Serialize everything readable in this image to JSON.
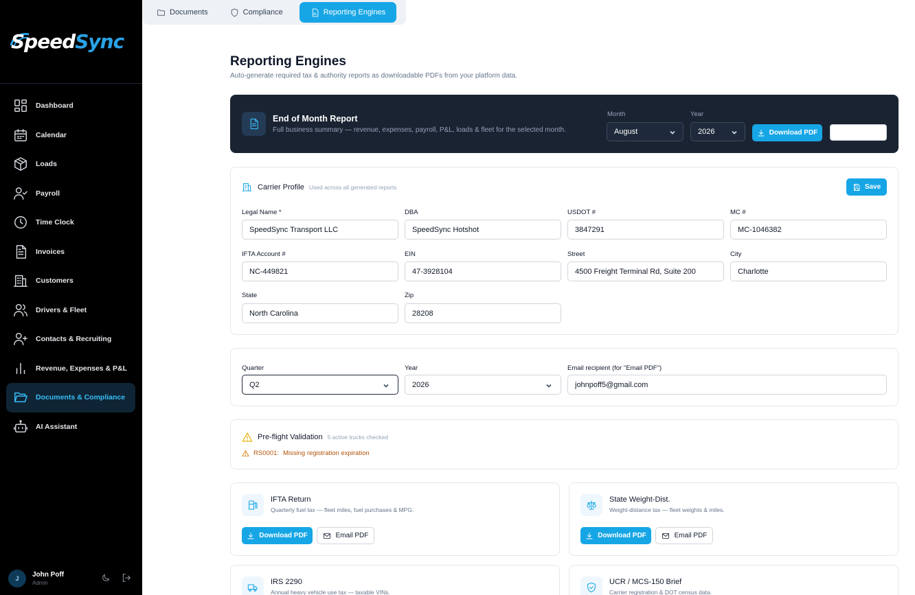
{
  "brand": {
    "name_part1": "Speed",
    "name_part2": "Sync",
    "accent": "#16a6e6"
  },
  "tabs": [
    {
      "label": "Documents",
      "icon": "folder-icon"
    },
    {
      "label": "Compliance",
      "icon": "shield-icon"
    },
    {
      "label": "Reporting Engines",
      "icon": "report-icon",
      "active": true
    }
  ],
  "sidebar": {
    "items": [
      {
        "label": "Dashboard",
        "icon": "dashboard-icon"
      },
      {
        "label": "Calendar",
        "icon": "calendar-icon"
      },
      {
        "label": "Loads",
        "icon": "box-icon"
      },
      {
        "label": "Payroll",
        "icon": "user-check-icon"
      },
      {
        "label": "Time Clock",
        "icon": "clock-icon"
      },
      {
        "label": "Invoices",
        "icon": "invoice-icon"
      },
      {
        "label": "Customers",
        "icon": "building-icon"
      },
      {
        "label": "Drivers & Fleet",
        "icon": "users-icon"
      },
      {
        "label": "Contacts & Recruiting",
        "icon": "user-plus-icon"
      },
      {
        "label": "Revenue, Expenses & P&L",
        "icon": "bar-chart-icon"
      },
      {
        "label": "Documents & Compliance",
        "icon": "folder-open-icon",
        "active": true
      },
      {
        "label": "AI Assistant",
        "icon": "bot-icon"
      }
    ]
  },
  "user": {
    "initial": "J",
    "name": "John Poff",
    "role": "Admin"
  },
  "page": {
    "title": "Reporting Engines",
    "subtitle": "Auto-generate required tax & authority reports as downloadable PDFs from your platform data."
  },
  "eom": {
    "title": "End of Month Report",
    "description": "Full business summary — revenue, expenses, payroll, P&L, loads & fleet for the selected month.",
    "month_label": "Month",
    "month_value": "August",
    "year_label": "Year",
    "year_value": "2026",
    "download_label": "Download PDF"
  },
  "carrier": {
    "title": "Carrier Profile",
    "note": "Used across all generated reports",
    "save_label": "Save",
    "fields": {
      "legal_name": {
        "label": "Legal Name *",
        "value": "SpeedSync Transport LLC"
      },
      "dba": {
        "label": "DBA",
        "value": "SpeedSync Hotshot"
      },
      "usdot": {
        "label": "USDOT #",
        "value": "3847291"
      },
      "mc": {
        "label": "MC #",
        "value": "MC-1046382"
      },
      "ifta": {
        "label": "IFTA Account #",
        "value": "NC-449821"
      },
      "ein": {
        "label": "EIN",
        "value": "47-3928104"
      },
      "street": {
        "label": "Street",
        "value": "4500 Freight Terminal Rd, Suite 200"
      },
      "city": {
        "label": "City",
        "value": "Charlotte"
      },
      "state": {
        "label": "State",
        "value": "North Carolina"
      },
      "zip": {
        "label": "Zip",
        "value": "28208"
      }
    }
  },
  "period": {
    "quarter_label": "Quarter",
    "quarter_value": "Q2",
    "year_label": "Year",
    "year_value": "2026",
    "email_label": "Email recipient (for \"Email PDF\")",
    "email_value": "johnpoff5@gmail.com"
  },
  "preflight": {
    "title": "Pre-flight Validation",
    "note": "5 active trucks checked",
    "warning_code": "RS0001:",
    "warning_text": "Missing registration expiration"
  },
  "reports": [
    {
      "title": "IFTA Return",
      "description": "Quarterly fuel tax — fleet miles, fuel purchases & MPG.",
      "icon": "fuel-icon",
      "download_label": "Download PDF",
      "email_label": "Email PDF"
    },
    {
      "title": "State Weight-Dist.",
      "description": "Weight-distance tax — fleet weights & miles.",
      "icon": "scale-icon",
      "download_label": "Download PDF",
      "email_label": "Email PDF"
    },
    {
      "title": "IRS 2290",
      "description": "Annual heavy vehicle use tax — taxable VINs.",
      "icon": "truck-icon"
    },
    {
      "title": "UCR / MCS-150 Brief",
      "description": "Carrier registration & DOT census data.",
      "icon": "shield-check-icon"
    }
  ]
}
